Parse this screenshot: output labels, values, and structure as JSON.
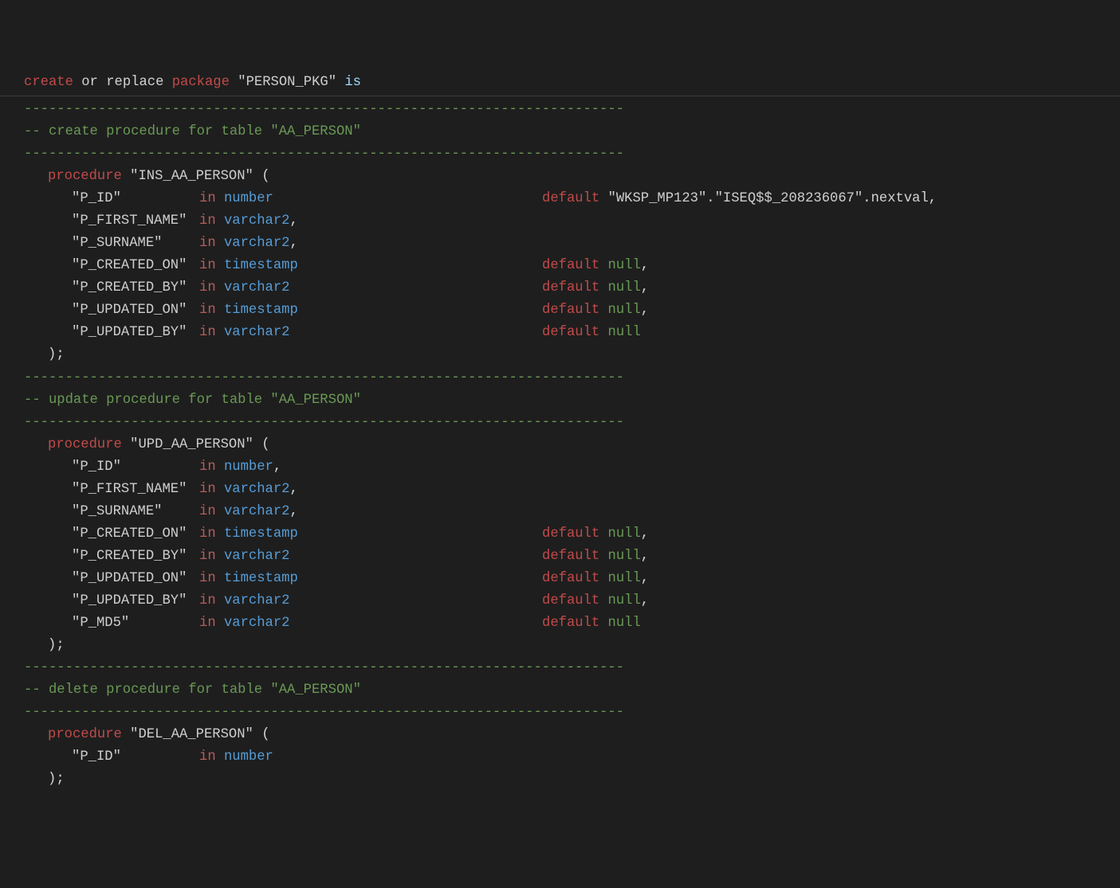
{
  "keywords": {
    "create": "create",
    "or": "or",
    "replace": "replace",
    "package": "package",
    "is": "is",
    "procedure": "procedure",
    "in": "in",
    "default": "default",
    "null": "null"
  },
  "pkg_name": "\"PERSON_PKG\"",
  "dashline": "-------------------------------------------------------------------------",
  "comments": {
    "create": "-- create procedure for table \"AA_PERSON\"",
    "update": "-- update procedure for table \"AA_PERSON\"",
    "delete": "-- delete procedure for table \"AA_PERSON\""
  },
  "procs": {
    "ins": {
      "name": "\"INS_AA_PERSON\"",
      "params": [
        {
          "name": "\"P_ID\"",
          "type": "number",
          "default_str": "\"WKSP_MP123\".\"ISEQ$$_208236067\"",
          "default_extra": ".nextval",
          "comma": ","
        },
        {
          "name": "\"P_FIRST_NAME\"",
          "type": "varchar2",
          "comma": ","
        },
        {
          "name": "\"P_SURNAME\"",
          "type": "varchar2",
          "comma": ","
        },
        {
          "name": "\"P_CREATED_ON\"",
          "type": "timestamp",
          "default_null": true,
          "comma": ","
        },
        {
          "name": "\"P_CREATED_BY\"",
          "type": "varchar2",
          "default_null": true,
          "comma": ","
        },
        {
          "name": "\"P_UPDATED_ON\"",
          "type": "timestamp",
          "default_null": true,
          "comma": ","
        },
        {
          "name": "\"P_UPDATED_BY\"",
          "type": "varchar2",
          "default_null": true,
          "comma": ""
        }
      ]
    },
    "upd": {
      "name": "\"UPD_AA_PERSON\"",
      "params": [
        {
          "name": "\"P_ID\"",
          "type": "number",
          "comma": ","
        },
        {
          "name": "\"P_FIRST_NAME\"",
          "type": "varchar2",
          "comma": ","
        },
        {
          "name": "\"P_SURNAME\"",
          "type": "varchar2",
          "comma": ","
        },
        {
          "name": "\"P_CREATED_ON\"",
          "type": "timestamp",
          "default_null": true,
          "comma": ","
        },
        {
          "name": "\"P_CREATED_BY\"",
          "type": "varchar2",
          "default_null": true,
          "comma": ","
        },
        {
          "name": "\"P_UPDATED_ON\"",
          "type": "timestamp",
          "default_null": true,
          "comma": ","
        },
        {
          "name": "\"P_UPDATED_BY\"",
          "type": "varchar2",
          "default_null": true,
          "comma": ","
        },
        {
          "name": "\"P_MD5\"",
          "type": "varchar2",
          "default_null": true,
          "comma": ""
        }
      ]
    },
    "del": {
      "name": "\"DEL_AA_PERSON\"",
      "params": [
        {
          "name": "\"P_ID\"",
          "type": "number",
          "comma": ""
        }
      ]
    }
  }
}
